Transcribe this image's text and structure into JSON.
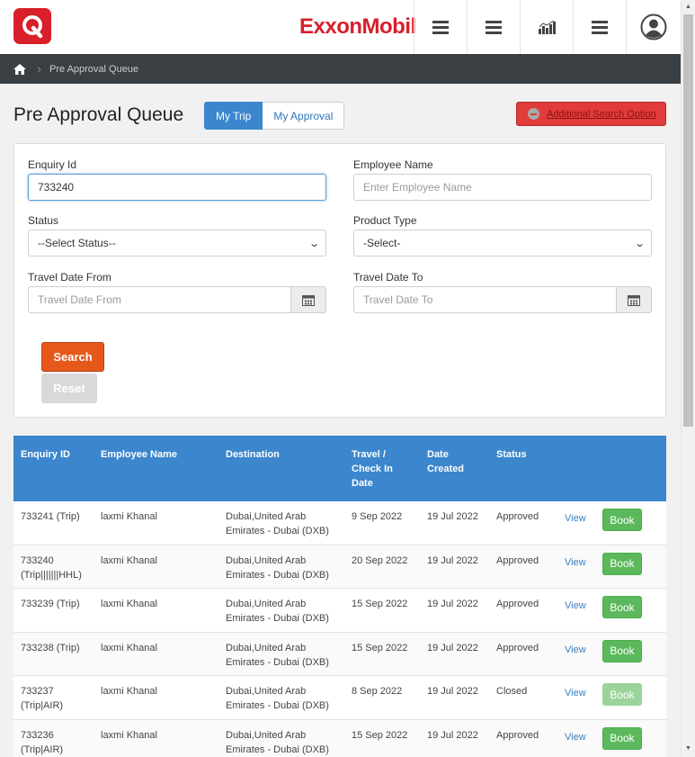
{
  "header": {
    "brand": "ExxonMobil",
    "nav_icons": [
      "menu-icon",
      "menu-icon",
      "chart-icon",
      "menu-icon",
      "user-icon"
    ]
  },
  "breadcrumb": {
    "items": [
      "Pre Approval Queue"
    ]
  },
  "page": {
    "title": "Pre Approval Queue",
    "tabs": [
      {
        "label": "My Trip",
        "active": true
      },
      {
        "label": "My Approval",
        "active": false
      }
    ],
    "advanced_search_label": "Additional Search Option"
  },
  "search": {
    "enquiry_id_label": "Enquiry Id",
    "enquiry_id_value": "733240",
    "employee_name_label": "Employee Name",
    "employee_name_placeholder": "Enter Employee Name",
    "status_label": "Status",
    "status_selected": "--Select Status--",
    "product_type_label": "Product Type",
    "product_type_selected": "-Select-",
    "travel_from_label": "Travel Date From",
    "travel_from_placeholder": "Travel Date From",
    "travel_to_label": "Travel Date To",
    "travel_to_placeholder": "Travel Date To",
    "search_button": "Search",
    "reset_button": "Reset"
  },
  "table": {
    "headers": {
      "enquiry_id": "Enquiry ID",
      "employee_name": "Employee Name",
      "destination": "Destination",
      "travel_date_1": "Travel /",
      "travel_date_2": "Check In",
      "travel_date_3": "Date",
      "date_created_1": "Date",
      "date_created_2": "Created",
      "status": "Status"
    },
    "rows": [
      {
        "id_1": "733241 (Trip)",
        "id_2": "",
        "employee": "laxmi Khanal",
        "dest_1": "Dubai,United Arab",
        "dest_2": "Emirates - Dubai (DXB)",
        "travel": "9 Sep 2022",
        "created": "19 Jul 2022",
        "status": "Approved",
        "view": "View",
        "book": "Book"
      },
      {
        "id_1": "733240",
        "id_2": "(Trip|||||||HHL)",
        "employee": "laxmi Khanal",
        "dest_1": "Dubai,United Arab",
        "dest_2": "Emirates - Dubai (DXB)",
        "travel": "20 Sep 2022",
        "created": "19 Jul 2022",
        "status": "Approved",
        "view": "View",
        "book": "Book"
      },
      {
        "id_1": "733239 (Trip)",
        "id_2": "",
        "employee": "laxmi Khanal",
        "dest_1": "Dubai,United Arab",
        "dest_2": "Emirates - Dubai (DXB)",
        "travel": "15 Sep 2022",
        "created": "19 Jul 2022",
        "status": "Approved",
        "view": "View",
        "book": "Book"
      },
      {
        "id_1": "733238 (Trip)",
        "id_2": "",
        "employee": "laxmi Khanal",
        "dest_1": "Dubai,United Arab",
        "dest_2": "Emirates - Dubai (DXB)",
        "travel": "15 Sep 2022",
        "created": "19 Jul 2022",
        "status": "Approved",
        "view": "View",
        "book": "Book"
      },
      {
        "id_1": "733237",
        "id_2": "(Trip|AIR)",
        "employee": "laxmi Khanal",
        "dest_1": "Dubai,United Arab",
        "dest_2": "Emirates - Dubai (DXB)",
        "travel": "8 Sep 2022",
        "created": "19 Jul 2022",
        "status": "Closed",
        "view": "View",
        "book": "Book"
      },
      {
        "id_1": "733236",
        "id_2": "(Trip|AIR)",
        "employee": "laxmi Khanal",
        "dest_1": "Dubai,United Arab",
        "dest_2": "Emirates - Dubai (DXB)",
        "travel": "15 Sep 2022",
        "created": "19 Jul 2022",
        "status": "Approved",
        "view": "View",
        "book": "Book"
      }
    ]
  },
  "colors": {
    "brand_red": "#d81f2a",
    "primary_blue": "#3b86cc",
    "search_orange": "#e6581a",
    "book_green": "#5cb85c",
    "advanced_red": "#e13b3b"
  }
}
